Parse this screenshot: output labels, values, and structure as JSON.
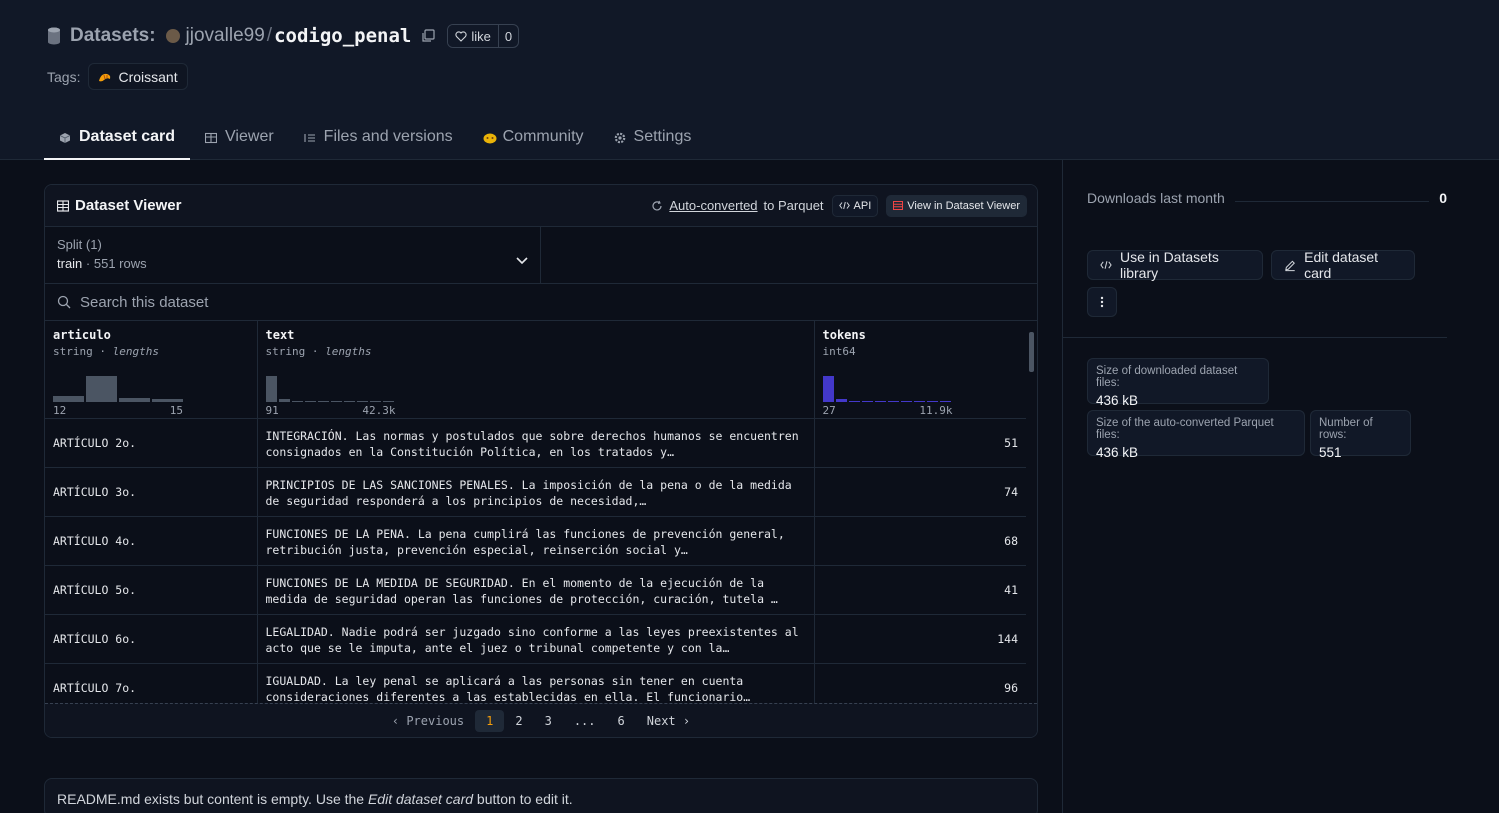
{
  "header": {
    "title_prefix": "Datasets:",
    "owner": "jjovalle99",
    "separator": "/",
    "repo": "codigo_penal",
    "like_label": "like",
    "like_count": "0",
    "tags_label": "Tags:",
    "tags": [
      {
        "label": "Croissant",
        "icon": "croissant-icon"
      }
    ]
  },
  "tabs": [
    {
      "label": "Dataset card",
      "icon": "cube-icon",
      "active": true
    },
    {
      "label": "Viewer",
      "icon": "table-icon"
    },
    {
      "label": "Files and versions",
      "icon": "files-icon"
    },
    {
      "label": "Community",
      "icon": "community-icon"
    },
    {
      "label": "Settings",
      "icon": "gear-icon"
    }
  ],
  "viewer": {
    "title": "Dataset Viewer",
    "auto_converted": "Auto-converted",
    "to_parquet": "to Parquet",
    "api_label": "API",
    "view_label": "View in Dataset Viewer",
    "split_label": "Split (1)",
    "split_name": "train",
    "split_rows": "551 rows",
    "search_placeholder": "Search this dataset",
    "columns": [
      {
        "name": "articulo",
        "type": "string",
        "type_extra": "lengths",
        "min": "12",
        "max": "15"
      },
      {
        "name": "text",
        "type": "string",
        "type_extra": "lengths",
        "min": "91",
        "max": "42.3k"
      },
      {
        "name": "tokens",
        "type": "int64",
        "type_extra": "",
        "min": "27",
        "max": "11.9k"
      }
    ],
    "rows": [
      {
        "articulo": "ARTÍCULO 2o.",
        "text": "INTEGRACIÓN. Las normas y postulados que sobre derechos humanos se encuentren consignados en la Constitución Política, en los tratados y…",
        "tokens": "51"
      },
      {
        "articulo": "ARTÍCULO 3o.",
        "text": "PRINCIPIOS DE LAS SANCIONES PENALES. La imposición de la pena o de la medida de seguridad responderá a los principios de necesidad,…",
        "tokens": "74"
      },
      {
        "articulo": "ARTÍCULO 4o.",
        "text": "FUNCIONES DE LA PENA. La pena cumplirá las funciones de prevención general, retribución justa, prevención especial, reinserción social y…",
        "tokens": "68"
      },
      {
        "articulo": "ARTÍCULO 5o.",
        "text": "FUNCIONES DE LA MEDIDA DE SEGURIDAD. En el momento de la ejecución de la medida de seguridad operan las funciones de protección, curación, tutela …",
        "tokens": "41"
      },
      {
        "articulo": "ARTÍCULO 6o.",
        "text": "LEGALIDAD. Nadie podrá ser juzgado sino conforme a las leyes preexistentes al acto que se le imputa, ante el juez o tribunal competente y con la…",
        "tokens": "144"
      },
      {
        "articulo": "ARTÍCULO 7o.",
        "text": "IGUALDAD. La ley penal se aplicará a las personas sin tener en cuenta consideraciones diferentes a las establecidas en ella. El funcionario…",
        "tokens": "96"
      }
    ],
    "pagination": {
      "prev": "Previous",
      "pages": [
        "1",
        "2",
        "3",
        "...",
        "6"
      ],
      "next": "Next",
      "current": "1"
    }
  },
  "readme": {
    "before": "README.md exists but content is empty. Use the ",
    "italic": "Edit dataset card",
    "after": " button to edit it."
  },
  "sidebar": {
    "downloads_label": "Downloads last month",
    "downloads_value": "0",
    "use_library": "Use in Datasets library",
    "edit_card": "Edit dataset card",
    "more_icon": "more-vertical-icon",
    "stats": [
      {
        "label": "Size of downloaded dataset files:",
        "value": "436 kB"
      },
      {
        "label": "Size of the auto-converted Parquet files:",
        "value": "436 kB"
      },
      {
        "label": "Number of rows:",
        "value": "551"
      }
    ]
  },
  "colors": {
    "background": "#0b0f19",
    "header_bg": "#111827",
    "border": "#1f2937",
    "accent_page": "#f59e0b",
    "hist_blue": "#4338ca"
  }
}
